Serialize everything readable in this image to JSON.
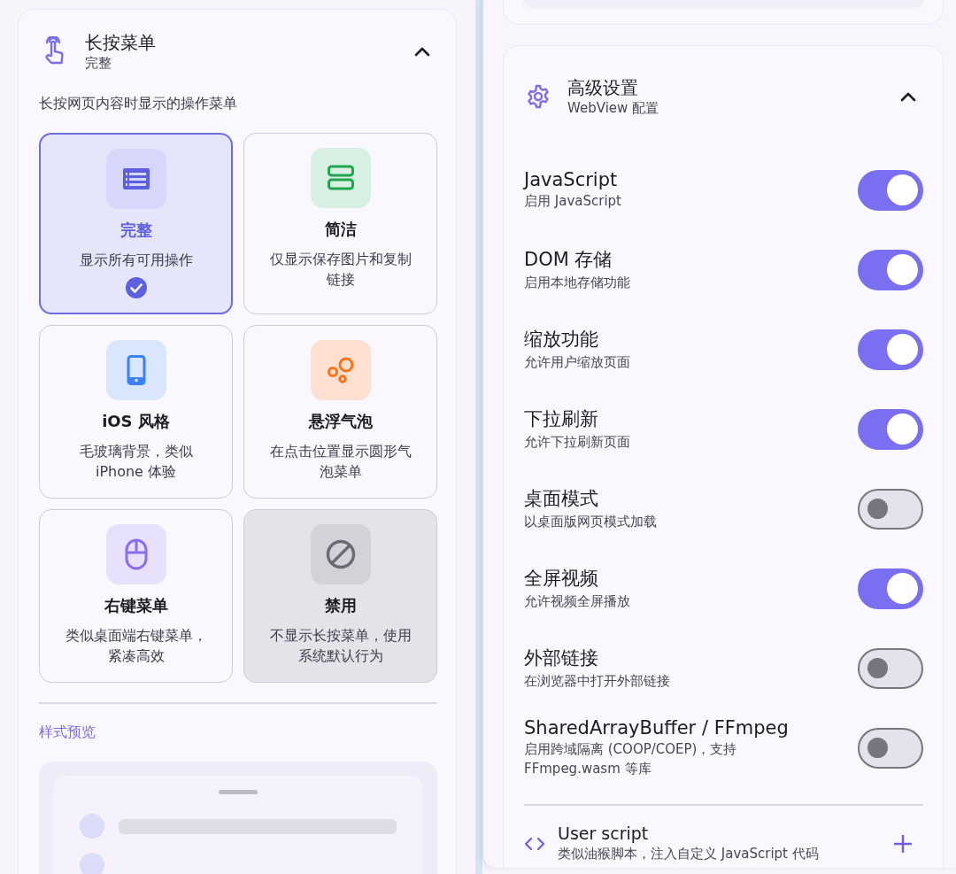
{
  "long_press_menu": {
    "title": "长按菜单",
    "subtitle": "完整",
    "expanded": true,
    "description": "长按网页内容时显示的操作菜单",
    "options": [
      {
        "kind": "full",
        "title": "完整",
        "description": "显示所有可用操作",
        "selected": true
      },
      {
        "kind": "compact",
        "title": "简洁",
        "description": "仅显示保存图片和复制链接",
        "selected": false
      },
      {
        "kind": "ios",
        "title": "iOS 风格",
        "description": "毛玻璃背景，类似 iPhone 体验",
        "selected": false
      },
      {
        "kind": "bubble",
        "title": "悬浮气泡",
        "description": "在点击位置显示圆形气泡菜单",
        "selected": false
      },
      {
        "kind": "context",
        "title": "右键菜单",
        "description": "类似桌面端右键菜单，紧凑高效",
        "selected": false
      },
      {
        "kind": "disabled",
        "title": "禁用",
        "description": "不显示长按菜单，使用系统默认行为",
        "selected": false
      }
    ],
    "preview_label": "样式预览"
  },
  "advanced_settings": {
    "title": "高级设置",
    "subtitle": "WebView 配置",
    "expanded": true,
    "toggles": [
      {
        "title": "JavaScript",
        "description": "启用 JavaScript",
        "on": true
      },
      {
        "title": "DOM 存储",
        "description": "启用本地存储功能",
        "on": true
      },
      {
        "title": "缩放功能",
        "description": "允许用户缩放页面",
        "on": true
      },
      {
        "title": "下拉刷新",
        "description": "允许下拉刷新页面",
        "on": true
      },
      {
        "title": "桌面模式",
        "description": "以桌面版网页模式加载",
        "on": false
      },
      {
        "title": "全屏视频",
        "description": "允许视频全屏播放",
        "on": true
      },
      {
        "title": "外部链接",
        "description": "在浏览器中打开外部链接",
        "on": false
      },
      {
        "title": "SharedArrayBuffer / FFmpeg",
        "description": "启用跨域隔离 (COOP/COEP)，支持 FFmpeg.wasm 等库",
        "on": false
      }
    ],
    "user_script": {
      "title": "User script",
      "description": "类似油猴脚本，注入自定义 JavaScript 代码"
    }
  }
}
